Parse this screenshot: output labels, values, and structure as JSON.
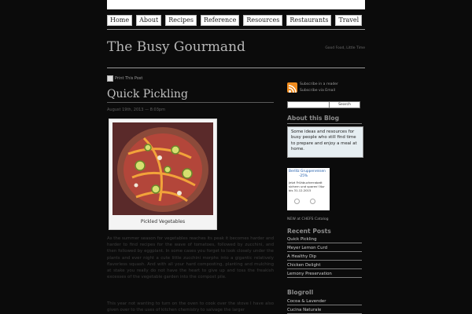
{
  "nav": {
    "items": [
      "Home",
      "About",
      "Recipes",
      "Reference",
      "Resources",
      "Restaurants",
      "Travel"
    ]
  },
  "site": {
    "title": "The Busy Gourmand",
    "tagline": "Good Food, Little Time"
  },
  "post": {
    "print_label": "Print This Post",
    "title": "Quick Pickling",
    "date": "August 19th, 2013 — 8:03pm",
    "figure_caption": "Pickled Vegetables",
    "paragraphs": [
      "As the summer season for vegetables reaches its peak it becomes harder and harder to find recipes for the wave of tomatoes, followed by zucchini, and then followed by eggplant. In some cases you forget to look closely under the plants and ever night a cute little zucchini morphs into a gigantic relatively flavorless squash. And with all your hard composting, planting and mulching at stake you really do not have the heart to give up and toss the freakish excesses of the vegetable garden into the compost pile.",
      "This year not wanting to turn on the oven to cook over the stove I have also given over to the uses of kitchen chemistry to salvage the larger"
    ]
  },
  "sidebar": {
    "subscribe_reader": "Subscribe in a reader",
    "subscribe_email": "Subscribe via Email",
    "search_button": "Search",
    "about_heading": "About this Blog",
    "about_text": "Some ideas and resources for busy people who still find time to prepare and enjoy a meal at home.",
    "ad": {
      "line1": "Berlitz Gruppenreisen",
      "line2": "-25%",
      "line3": "Jetzt Frühbucherrabatt",
      "line4": "sichern und sparen! Nur",
      "line5": "bis 31.12.2015"
    },
    "catalog_label": "NEW at CHEFS Catalog",
    "recent_heading": "Recent Posts",
    "recent_posts": [
      "Quick Pickling",
      "Meyer Lemon Curd",
      "A Healthy Dip",
      "Chicken Delight",
      "Lemony Preservation"
    ],
    "blogroll_heading": "Blogroll",
    "blogroll": [
      "Cocoa & Lavender",
      "Cucina Naturale"
    ]
  },
  "colors": {
    "background": "#0b0b0b",
    "rss": "#f08c1e",
    "about_box": "#e6eef2"
  }
}
